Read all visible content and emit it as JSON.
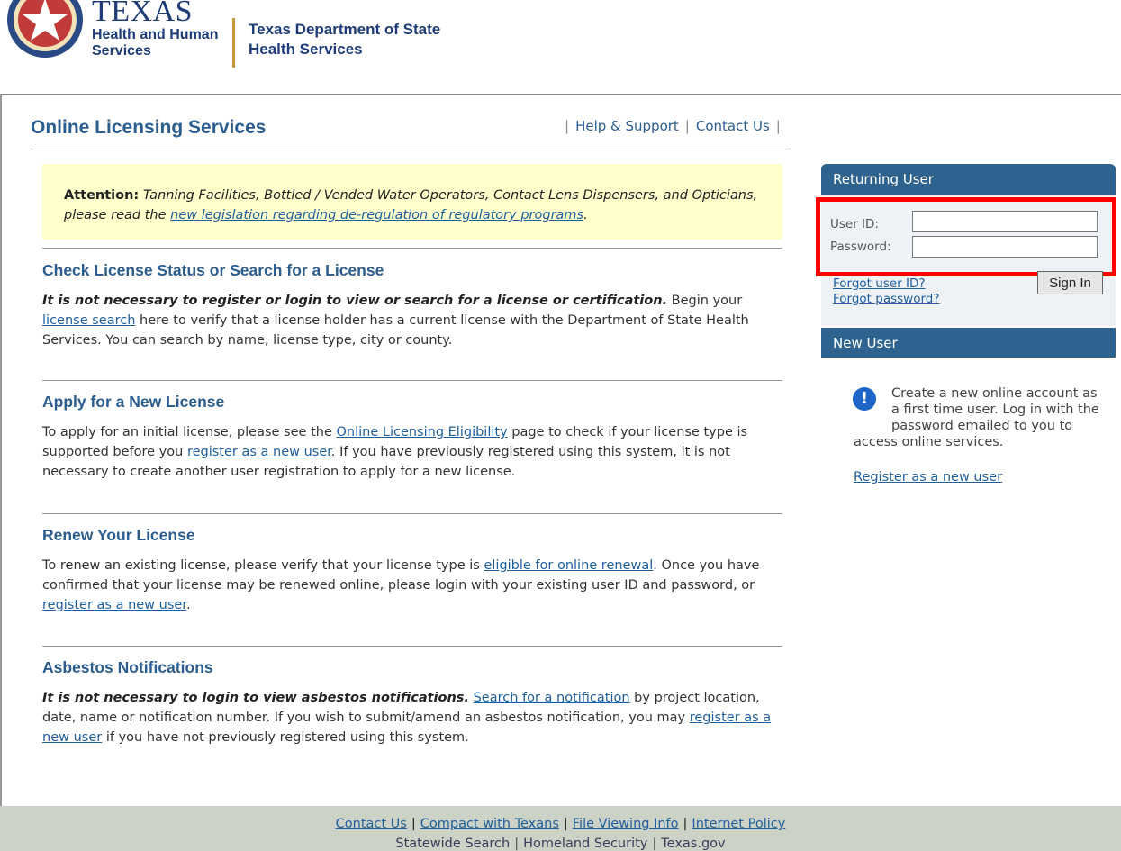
{
  "header": {
    "hhs_title": "TEXAS",
    "hhs_sub1": "Health and Human",
    "hhs_sub2": "Services",
    "dshs_line1": "Texas Department of State",
    "dshs_line2": "Health Services"
  },
  "page_title": "Online Licensing Services",
  "top_nav": {
    "help": "Help & Support",
    "contact": "Contact Us"
  },
  "attention": {
    "label": "Attention:",
    "text": "Tanning Facilities, Bottled / Vended Water Operators, Contact Lens Dispensers, and Opticians, please read the",
    "link": "new legislation regarding de-regulation of regulatory programs",
    "end": "."
  },
  "sections": {
    "check": {
      "title": "Check License Status or Search for a License",
      "bold": "It is not necessary to register or login to view or search for a license or certification.",
      "t1": " Begin your ",
      "link1": "license search",
      "t2": " here to verify that a license holder has a current license with the Department of State Health Services. You can search by name, license type, city or county."
    },
    "apply": {
      "title": "Apply for a New License",
      "t1": "To apply for an initial license, please see the ",
      "link1": "Online Licensing Eligibility",
      "t2": " page to check if your license type is supported before you ",
      "link2": "register as a new user",
      "t3": ". If you have previously registered using this system, it is not necessary to create another user registration to apply for a new license."
    },
    "renew": {
      "title": "Renew Your License",
      "t1": "To renew an existing license, please verify that your license type is ",
      "link1": "eligible for online renewal",
      "t2": ". Once you have confirmed that your license may be renewed online, please login with your existing user ID and password, or ",
      "link2": "register as a new user",
      "t3": "."
    },
    "asbestos": {
      "title": "Asbestos Notifications",
      "bold": "It is not necessary to login to view asbestos notifications.",
      "t1": " ",
      "link1": "Search for a notification",
      "t2": " by project location, date, name or notification number. If you wish to submit/amend an asbestos notification, you may ",
      "link2": "register as a new user",
      "t3": " if you have not previously registered using this system."
    }
  },
  "returning_user": {
    "heading": "Returning User",
    "user_id_label": "User ID:",
    "password_label": "Password:",
    "user_id_value": "",
    "password_value": "",
    "forgot_user": "Forgot user ID?",
    "forgot_password": "Forgot password?",
    "sign_in": "Sign In"
  },
  "new_user": {
    "heading": "New User",
    "icon": "info-icon",
    "text": "Create a new online account as a first time user. Log in with the password emailed to you to access online services.",
    "register_link": "Register as a new user"
  },
  "footer": {
    "row1": [
      "Contact Us",
      "Compact with Texans",
      "File Viewing Info",
      "Internet Policy"
    ],
    "row2": [
      "Statewide Search",
      "Homeland Security",
      "Texas.gov"
    ]
  },
  "colors": {
    "brand_blue": "#2b5d8f",
    "panel_header": "#2e6390",
    "attention_bg": "#ffffcc",
    "highlight_box": "#ff0000",
    "footer_bg": "#ccd3c6"
  }
}
